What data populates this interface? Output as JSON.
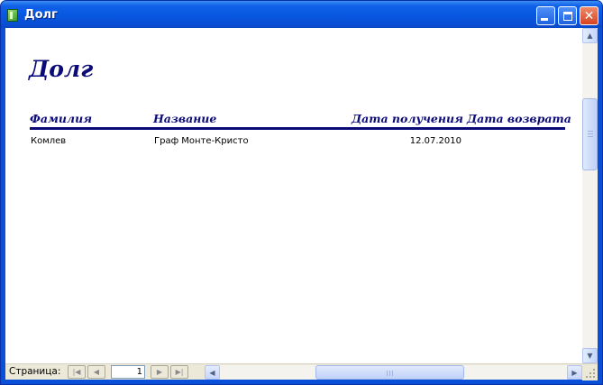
{
  "window": {
    "title": "Долг",
    "controls": {
      "minimize": "minimize",
      "maximize": "maximize",
      "close": "✕"
    }
  },
  "report": {
    "title": "Долг",
    "columns": [
      "Фамилия",
      "Название",
      "Дата получения",
      "Дата возврата"
    ],
    "rows": [
      {
        "surname": "Комлев",
        "book": "Граф Монте-Кристо",
        "received": "12.07.2010",
        "returned": ""
      }
    ]
  },
  "navigation": {
    "page_label": "Страница:",
    "current_page": "1",
    "first_icon": "first-page-icon",
    "prev_icon": "prev-page-icon",
    "next_icon": "next-page-icon",
    "last_icon": "last-page-icon"
  },
  "colors": {
    "title_bar": "#0856e0",
    "report_text": "#0b0a79",
    "close_button": "#d64320"
  }
}
